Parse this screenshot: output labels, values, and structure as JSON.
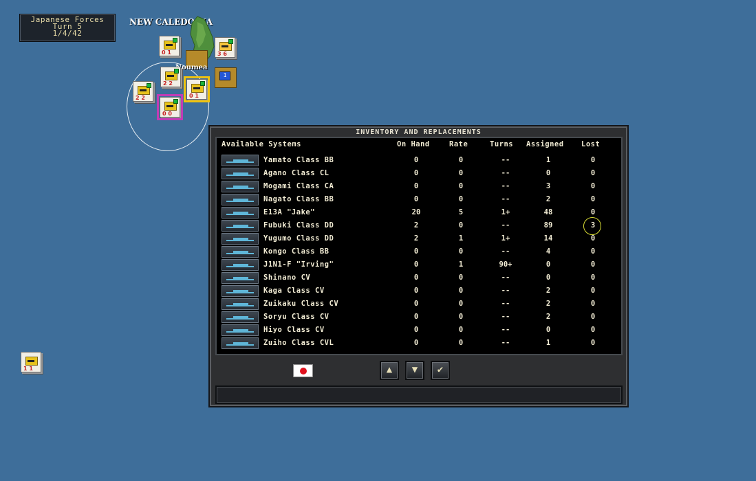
{
  "map": {
    "side_info": {
      "title": "Japanese Forces",
      "turn": "Turn 5",
      "date": "1/4/42"
    },
    "region_label": "NEW CALEDONIA",
    "town_label": "Noumea",
    "colors": {
      "ocean": "#3e6e9a",
      "island": "#4f8f3c",
      "counter_air": "#e7c21c",
      "hex_highlight_pink": "#c03cb5",
      "hex_highlight_yellow": "#f0c30e"
    }
  },
  "dialog": {
    "title": "INVENTORY AND REPLACEMENTS",
    "columns": {
      "systems": "Available Systems",
      "on_hand": "On Hand",
      "rate": "Rate",
      "turns": "Turns",
      "assigned": "Assigned",
      "lost": "Lost"
    },
    "rows": [
      {
        "name": "Yamato Class BB",
        "on_hand": "0",
        "rate": "0",
        "turns": "--",
        "assigned": "1",
        "lost": "0",
        "icon": "ship-icon"
      },
      {
        "name": "Agano Class CL",
        "on_hand": "0",
        "rate": "0",
        "turns": "--",
        "assigned": "0",
        "lost": "0",
        "icon": "ship-icon"
      },
      {
        "name": "Mogami Class CA",
        "on_hand": "0",
        "rate": "0",
        "turns": "--",
        "assigned": "3",
        "lost": "0",
        "icon": "ship-icon"
      },
      {
        "name": "Nagato Class BB",
        "on_hand": "0",
        "rate": "0",
        "turns": "--",
        "assigned": "2",
        "lost": "0",
        "icon": "ship-icon"
      },
      {
        "name": "E13A \"Jake\"",
        "on_hand": "20",
        "rate": "5",
        "turns": "1+",
        "assigned": "48",
        "lost": "0",
        "icon": "aircraft-icon"
      },
      {
        "name": "Fubuki Class DD",
        "on_hand": "2",
        "rate": "0",
        "turns": "--",
        "assigned": "89",
        "lost": "3",
        "icon": "ship-icon"
      },
      {
        "name": "Yugumo Class DD",
        "on_hand": "2",
        "rate": "1",
        "turns": "1+",
        "assigned": "14",
        "lost": "0",
        "icon": "ship-icon"
      },
      {
        "name": "Kongo Class BB",
        "on_hand": "0",
        "rate": "0",
        "turns": "--",
        "assigned": "4",
        "lost": "0",
        "icon": "ship-icon"
      },
      {
        "name": "J1N1-F \"Irving\"",
        "on_hand": "0",
        "rate": "1",
        "turns": "90+",
        "assigned": "0",
        "lost": "0",
        "icon": "aircraft-icon"
      },
      {
        "name": "Shinano CV",
        "on_hand": "0",
        "rate": "0",
        "turns": "--",
        "assigned": "0",
        "lost": "0",
        "icon": "ship-icon"
      },
      {
        "name": "Kaga Class CV",
        "on_hand": "0",
        "rate": "0",
        "turns": "--",
        "assigned": "2",
        "lost": "0",
        "icon": "ship-icon"
      },
      {
        "name": "Zuikaku Class CV",
        "on_hand": "0",
        "rate": "0",
        "turns": "--",
        "assigned": "2",
        "lost": "0",
        "icon": "ship-icon"
      },
      {
        "name": "Soryu Class CV",
        "on_hand": "0",
        "rate": "0",
        "turns": "--",
        "assigned": "2",
        "lost": "0",
        "icon": "ship-icon"
      },
      {
        "name": "Hiyo Class CV",
        "on_hand": "0",
        "rate": "0",
        "turns": "--",
        "assigned": "0",
        "lost": "0",
        "icon": "ship-icon"
      },
      {
        "name": "Zuiho Class CVL",
        "on_hand": "0",
        "rate": "0",
        "turns": "--",
        "assigned": "1",
        "lost": "0",
        "icon": "ship-icon"
      }
    ],
    "buttons": {
      "scroll_up": "▲",
      "scroll_down": "▼",
      "confirm": "✔"
    },
    "flag_icon": "japan-flag-icon"
  }
}
